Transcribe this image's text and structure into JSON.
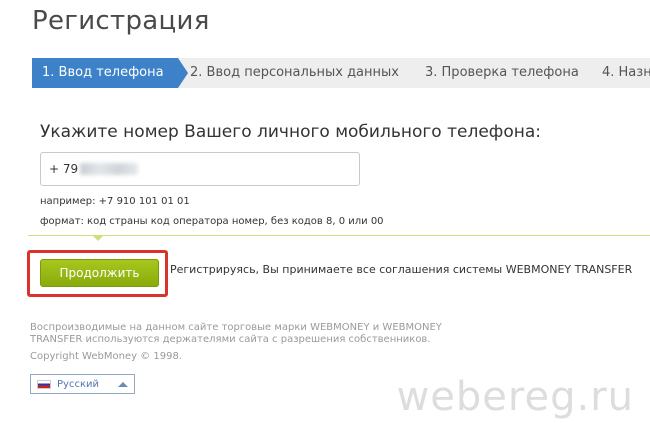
{
  "page": {
    "title": "Регистрация"
  },
  "steps": [
    {
      "label": "1. Ввод телефона"
    },
    {
      "label": "2. Ввод персональных данных"
    },
    {
      "label": "3. Проверка телефона"
    },
    {
      "label": "4. Назн"
    }
  ],
  "phone_form": {
    "heading": "Укажите номер Вашего личного мобильного телефона:",
    "input_value": "+ 79",
    "example": "например: +7 910 101 01 01",
    "format": "формат: код страны код оператора номер, без кодов 8, 0 или 00"
  },
  "actions": {
    "continue_label": "Продолжить",
    "agreement_text": "Регистрируясь, Вы принимаете все соглашения системы WEBMONEY TRANSFER"
  },
  "footer": {
    "trademark_text": "Воспроизводимые на данном сайте торговые марки WEBMONEY и WEBMONEY TRANSFER используются держателями сайта с разрешения собственников.",
    "copyright": "Copyright WebMoney © 1998."
  },
  "language": {
    "selected": "Русский",
    "flag_icon": "russia-flag-icon",
    "toggle_icon": "chevron-up-icon"
  },
  "watermark": "webereg.ru",
  "colors": {
    "active_step": "#3d82c8",
    "continue_button": "#98b814",
    "highlight_frame": "#d9342b"
  }
}
